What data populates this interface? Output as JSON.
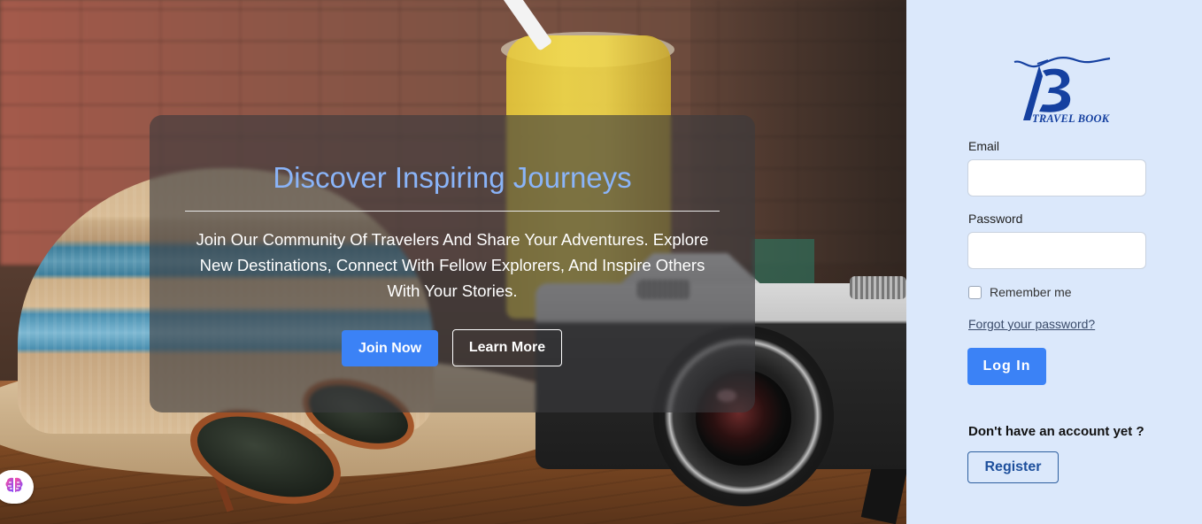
{
  "hero": {
    "title": "Discover Inspiring Journeys",
    "description": "Join Our Community Of Travelers And Share Your Adventures. Explore New Destinations, Connect With Fellow Explorers, And Inspire Others With Your Stories.",
    "join_label": "Join Now",
    "learn_label": "Learn More"
  },
  "brand": {
    "name": "TRAVEL BOOK",
    "color": "#1540a0"
  },
  "login": {
    "email_label": "Email",
    "email_value": "",
    "password_label": "Password",
    "password_value": "",
    "remember_label": "Remember me",
    "remember_checked": false,
    "forgot_label": "Forgot your password?",
    "login_label": "Log In",
    "no_account_text": "Don't have an account yet ?",
    "register_label": "Register"
  },
  "colors": {
    "accent": "#3b82f6",
    "title": "#8ab4f8",
    "panel_bg": "#dbe8fb"
  },
  "icons": {
    "assistant": "brain-icon",
    "logo": "travel-book-logo"
  }
}
